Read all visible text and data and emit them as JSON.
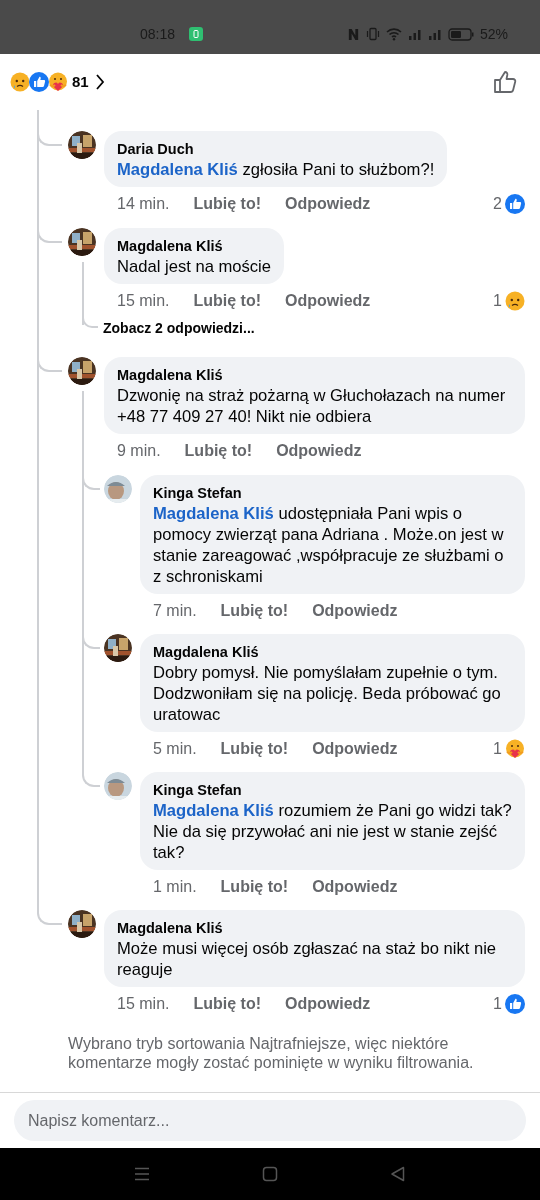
{
  "status_bar": {
    "time": "08:18",
    "battery": "52%"
  },
  "header": {
    "reactions": [
      {
        "kind": "sad"
      },
      {
        "kind": "like"
      },
      {
        "kind": "care"
      }
    ],
    "count": "81"
  },
  "comments": [
    {
      "author": "Daria Duch",
      "mention": "Magdalena Kliś",
      "text": "zgłosiła Pani to służbom?!",
      "time": "14 min.",
      "like": "Lubię to!",
      "reply": "Odpowiedz",
      "reaction": {
        "count": "2",
        "kind": "like"
      }
    },
    {
      "author": "Magdalena Kliś",
      "text": "Nadal jest na moście",
      "time": "15 min.",
      "like": "Lubię to!",
      "reply": "Odpowiedz",
      "reaction": {
        "count": "1",
        "kind": "sad"
      },
      "more_replies": "Zobacz 2 odpowiedzi..."
    },
    {
      "author": "Magdalena Kliś",
      "text": "Dzwonię na straż pożarną w Głuchołazach na numer +48 77 409 27 40! Nikt nie odbiera",
      "time": "9 min.",
      "like": "Lubię to!",
      "reply": "Odpowiedz",
      "children": [
        {
          "author": "Kinga Stefan",
          "mention": "Magdalena Kliś",
          "text": "udostępniała Pani wpis o pomocy zwierząt pana Adriana . Może.on jest w stanie zareagować ,współpracuje ze służbami o z schroniskami",
          "time": "7 min.",
          "like": "Lubię to!",
          "reply": "Odpowiedz"
        },
        {
          "author": "Magdalena Kliś",
          "text": "Dobry pomysł. Nie pomyślałam zupełnie o tym. Dodzwoniłam się na policję. Beda próbować go uratowac",
          "time": "5 min.",
          "like": "Lubię to!",
          "reply": "Odpowiedz",
          "reaction": {
            "count": "1",
            "kind": "care"
          }
        },
        {
          "author": "Kinga Stefan",
          "mention": "Magdalena Kliś",
          "text": "rozumiem że Pani go widzi tak? Nie da się przywołać ani nie jest w stanie zejść tak?",
          "time": "1 min.",
          "like": "Lubię to!",
          "reply": "Odpowiedz"
        }
      ]
    },
    {
      "author": "Magdalena Kliś",
      "text": "Może musi więcej osób zgłaszać na staż bo nikt nie reaguje",
      "time": "15 min.",
      "like": "Lubię to!",
      "reply": "Odpowiedz",
      "reaction": {
        "count": "1",
        "kind": "like"
      }
    }
  ],
  "filter_note": "Wybrano tryb sortowania Najtrafniejsze, więc niektóre komentarze mogły zostać pominięte w wyniku filtrowania.",
  "composer": {
    "placeholder": "Napisz komentarz..."
  }
}
